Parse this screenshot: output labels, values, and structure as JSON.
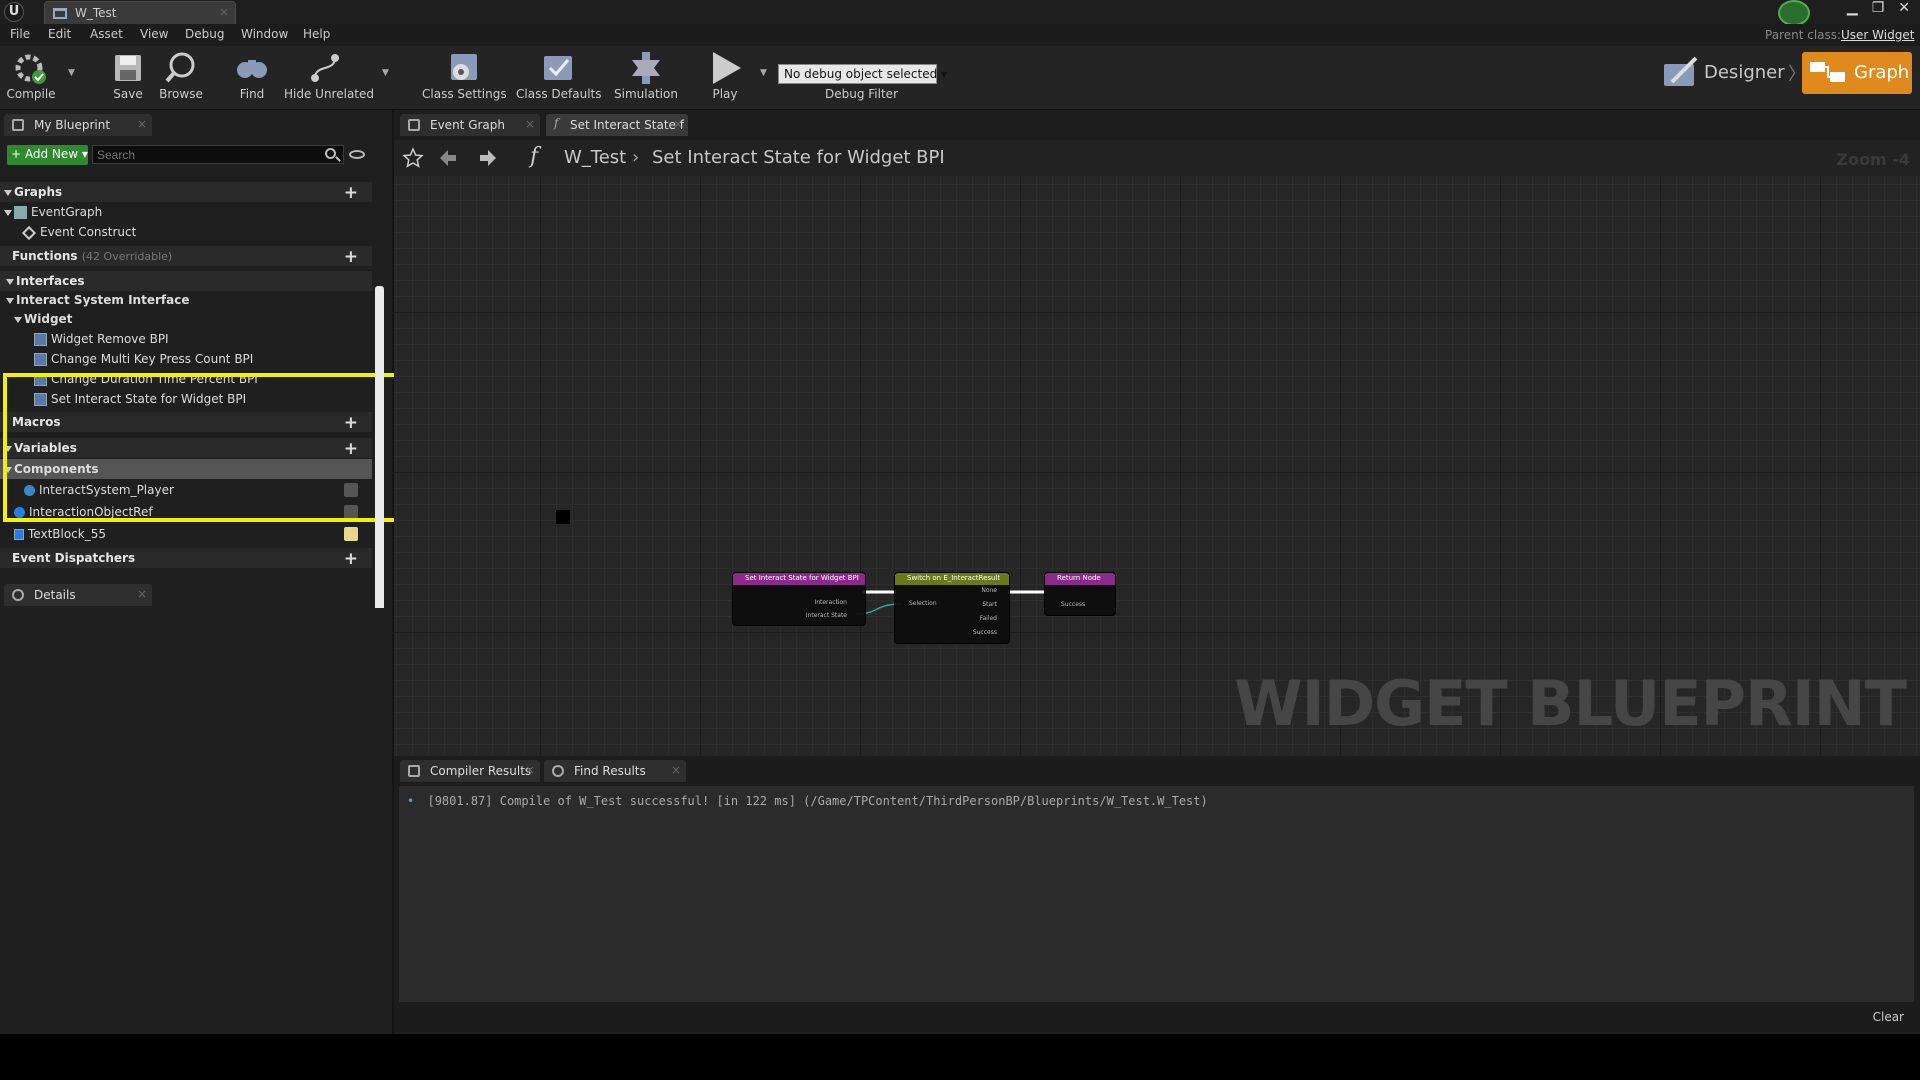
{
  "window": {
    "doc_tab": "W_Test",
    "parent_class_label": "Parent class:",
    "parent_class_value": "User Widget"
  },
  "menu": [
    "File",
    "Edit",
    "Asset",
    "View",
    "Debug",
    "Window",
    "Help"
  ],
  "toolbar": {
    "compile": "Compile",
    "save": "Save",
    "browse": "Browse",
    "find": "Find",
    "hide_unrelated": "Hide Unrelated",
    "class_settings": "Class Settings",
    "class_defaults": "Class Defaults",
    "simulation": "Simulation",
    "play": "Play",
    "debug_select": "No debug object selected",
    "debug_filter": "Debug Filter",
    "designer": "Designer",
    "graph": "Graph"
  },
  "left": {
    "tab": "My Blueprint",
    "add_new": "Add New",
    "search_placeholder": "Search",
    "graphs": "Graphs",
    "event_graph": "EventGraph",
    "event_construct": "Event Construct",
    "functions": "Functions",
    "functions_sub": "(42 Overridable)",
    "interfaces": "Interfaces",
    "interface_name": "Interact System Interface",
    "widget": "Widget",
    "iface_items": [
      "Widget Remove BPI",
      "Change Multi Key Press Count BPI",
      "Change Duration Time Percent BPI",
      "Set Interact State for Widget BPI"
    ],
    "macros": "Macros",
    "variables": "Variables",
    "components": "Components",
    "var_items": [
      "InteractSystem_Player",
      "InteractionObjectRef",
      "TextBlock_55"
    ],
    "dispatchers": "Event Dispatchers",
    "details_tab": "Details"
  },
  "graph": {
    "tabs": [
      "Event Graph",
      "Set Interact State f"
    ],
    "crumb_root": "W_Test",
    "crumb_fn": "Set Interact State for Widget BPI",
    "zoom": "Zoom -4",
    "watermark": "WIDGET BLUEPRINT",
    "node1": {
      "title": "Set Interact State for Widget BPI",
      "pins": [
        "Interaction",
        "Interact State"
      ]
    },
    "node2": {
      "title": "Switch on E_InteractResult",
      "in_pin": "Selection",
      "outs": [
        "None",
        "Start",
        "Failed",
        "Success"
      ]
    },
    "node3": {
      "title": "Return Node",
      "pin": "Success"
    }
  },
  "bottom": {
    "tabs": [
      "Compiler Results",
      "Find Results"
    ],
    "log_line": "[9801.87] Compile of W_Test successful! [in 122 ms] (/Game/TPContent/ThirdPersonBP/Blueprints/W_Test.W_Test)",
    "clear": "Clear"
  },
  "colors": {
    "accent": "#e08a1e",
    "highlight": "#f2f200",
    "function_node": "#8a2a8a",
    "switch_node": "#6a7a1a"
  }
}
